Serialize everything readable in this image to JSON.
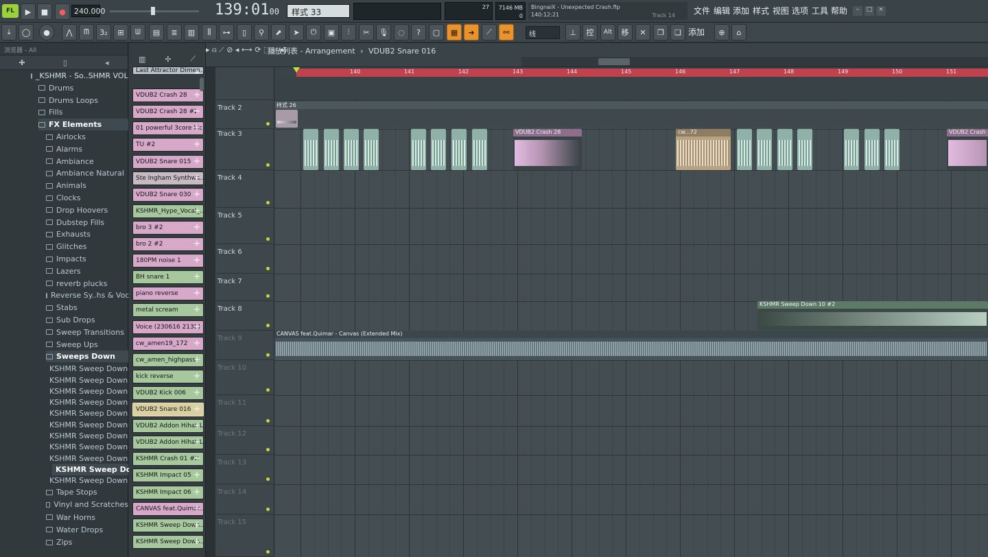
{
  "header": {
    "tempo": "240.000",
    "position": "139:01",
    "position_sub": "00",
    "pattern_label": "样式 33",
    "cpu": "27",
    "memory": "7146 MB",
    "memory_sub": "0",
    "project_title": "BingnaiX - Unexpected Crash.flp",
    "hint_position": "140:12:21",
    "hint_track": "Track 14",
    "logo": "FL",
    "menus": [
      "文件",
      "编辑",
      "添加",
      "样式",
      "视图",
      "选项",
      "工具",
      "帮助"
    ],
    "snap": "线",
    "add_label": "添加"
  },
  "browser": {
    "title": "浏览器 - All",
    "root": "_KSHMR - So..SHMR VOL 2",
    "folders": [
      {
        "label": "Drums",
        "level": 1
      },
      {
        "label": "Drums Loops",
        "level": 1
      },
      {
        "label": "Fills",
        "level": 1
      },
      {
        "label": "FX Elements",
        "level": 1
      },
      {
        "label": "Airlocks",
        "level": 2
      },
      {
        "label": "Alarms",
        "level": 2
      },
      {
        "label": "Ambiance",
        "level": 2
      },
      {
        "label": "Ambiance Natural",
        "level": 2
      },
      {
        "label": "Animals",
        "level": 2
      },
      {
        "label": "Clocks",
        "level": 2
      },
      {
        "label": "Drop Hoovers",
        "level": 2
      },
      {
        "label": "Dubstep Fills",
        "level": 2
      },
      {
        "label": "Exhausts",
        "level": 2
      },
      {
        "label": "Glitches",
        "level": 2
      },
      {
        "label": "Impacts",
        "level": 2
      },
      {
        "label": "Lazers",
        "level": 2
      },
      {
        "label": "reverb plucks",
        "level": 2
      },
      {
        "label": "Reverse Sy..hs & Vocals",
        "level": 2
      },
      {
        "label": "Stabs",
        "level": 2
      },
      {
        "label": "Sub Drops",
        "level": 2
      },
      {
        "label": "Sweep Transitions",
        "level": 2
      },
      {
        "label": "Sweep Ups",
        "level": 2
      },
      {
        "label": "Sweeps Down",
        "level": 2
      }
    ],
    "files": [
      "KSHMR Sweep Down 01",
      "KSHMR Sweep Down 02",
      "KSHMR Sweep Down 03",
      "KSHMR Sweep Down 04",
      "KSHMR Sweep Down 05",
      "KSHMR Sweep Down 06",
      "KSHMR Sweep Down 07",
      "KSHMR Sweep Down 08",
      "KSHMR Sweep Down 09",
      "KSHMR Sweep Down 10",
      "KSHMR Sweep Down 11"
    ],
    "selected_file": "KSHMR Sweep Down 10",
    "after": [
      "Tape Stops",
      "Vinyl and Scratches",
      "War Horns",
      "Water Drops",
      "Zips"
    ]
  },
  "channels": [
    {
      "label": "Last Attractor Dimen...",
      "color": "#b9c3c8"
    },
    {
      "label": "VDUB2 Crash 28",
      "color": "#d8a8c8"
    },
    {
      "label": "VDUB2 Crash 28 #2",
      "color": "#d8a8c8"
    },
    {
      "label": "01 powerful 3core kic...",
      "color": "#d8a8c8"
    },
    {
      "label": "TU #2",
      "color": "#d8a8c8"
    },
    {
      "label": "VDUB2 Snare 015",
      "color": "#d8a8c8"
    },
    {
      "label": "Ste Ingham Synthwa...",
      "color": "#c9b9c2"
    },
    {
      "label": "VDUB2 Snare 030",
      "color": "#d8a8c8"
    },
    {
      "label": "KSHMR_Hype_Vocal_...",
      "color": "#a7c79c"
    },
    {
      "label": "bro 3 #2",
      "color": "#d8a8c8"
    },
    {
      "label": "bro 2 #2",
      "color": "#d8a8c8"
    },
    {
      "label": "180PM noise 1",
      "color": "#d8a8c8"
    },
    {
      "label": "BH snare 1",
      "color": "#a7c79c"
    },
    {
      "label": "piano reverse",
      "color": "#d8a8c8"
    },
    {
      "label": "metal scream",
      "color": "#a7c79c"
    },
    {
      "label": "Voice (230616 2130)",
      "color": "#d8a8c8"
    },
    {
      "label": "cw_amen19_172",
      "color": "#d8a8c8"
    },
    {
      "label": "cw_amen_highpass",
      "color": "#a7c79c"
    },
    {
      "label": "kick reverse",
      "color": "#a7c79c"
    },
    {
      "label": "VDUB2 Kick 006",
      "color": "#a7c79c"
    },
    {
      "label": "VDUB2 Snare 016",
      "color": "#d9cfa0"
    },
    {
      "label": "VDUB2 Addon Hihat L...",
      "color": "#a7c79c"
    },
    {
      "label": "VDUB2 Addon Hihat L...",
      "color": "#a7c79c"
    },
    {
      "label": "KSHMR Crash 01 #2",
      "color": "#a7c79c"
    },
    {
      "label": "KSHMR Impact 05",
      "color": "#a7c79c"
    },
    {
      "label": "KSHMR Impact 06",
      "color": "#a7c79c"
    },
    {
      "label": "CANVAS feat.Quimar...",
      "color": "#d8a8c8"
    },
    {
      "label": "KSHMR Sweep Down...",
      "color": "#a7c79c"
    },
    {
      "label": "KSHMR Sweep Down...",
      "color": "#a7c79c"
    }
  ],
  "playlist": {
    "breadcrumb": "播放列表 - Arrangement",
    "breadcrumb_sep": "›",
    "breadcrumb_channel": "VDUB2 Snare 016",
    "bars": [
      "140",
      "141",
      "142",
      "143",
      "144",
      "145",
      "146",
      "147",
      "148",
      "149",
      "150",
      "151"
    ],
    "tracks": [
      {
        "label": "Track 2"
      },
      {
        "label": "Track 3"
      },
      {
        "label": "Track 4"
      },
      {
        "label": "Track 5"
      },
      {
        "label": "Track 6"
      },
      {
        "label": "Track 7"
      },
      {
        "label": "Track 8"
      },
      {
        "label": "Track 9"
      },
      {
        "label": "Track 10"
      },
      {
        "label": "Track 11"
      },
      {
        "label": "Track 12"
      },
      {
        "label": "Track 13"
      },
      {
        "label": "Track 14"
      },
      {
        "label": "Track 15"
      }
    ],
    "clips": {
      "pattern": "样式 26",
      "crash1": "VDUB2 Crash 28",
      "cw": "cw...72",
      "crash2": "VDUB2 Crash",
      "sweep": "KSHMR Sweep Down 10 #2",
      "canvas": "CANVAS feat.Quimar - Canvas (Extended Mix)"
    }
  }
}
